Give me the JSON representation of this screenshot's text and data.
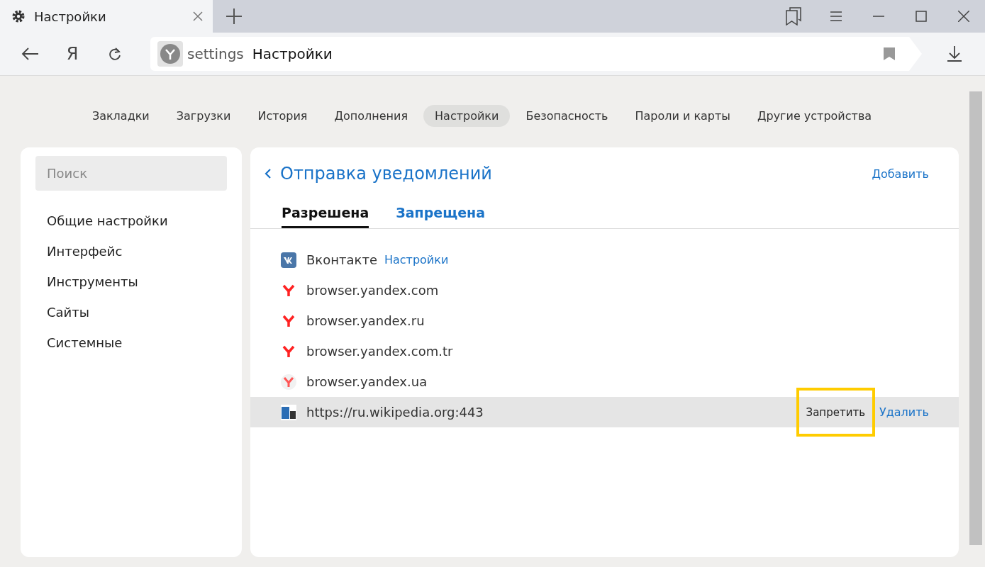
{
  "tab": {
    "title": "Настройки"
  },
  "toolbar": {
    "home_key": "Я",
    "address_scheme": "settings",
    "address_title": "Настройки"
  },
  "nav": [
    {
      "label": "Закладки",
      "selected": false
    },
    {
      "label": "Загрузки",
      "selected": false
    },
    {
      "label": "История",
      "selected": false
    },
    {
      "label": "Дополнения",
      "selected": false
    },
    {
      "label": "Настройки",
      "selected": true
    },
    {
      "label": "Безопасность",
      "selected": false
    },
    {
      "label": "Пароли и карты",
      "selected": false
    },
    {
      "label": "Другие устройства",
      "selected": false
    }
  ],
  "sidebar": {
    "search": {
      "placeholder": "Поиск"
    },
    "items": [
      "Общие настройки",
      "Интерфейс",
      "Инструменты",
      "Сайты",
      "Системные"
    ]
  },
  "panel": {
    "title": "Отправка уведомлений",
    "add": "Добавить",
    "tabs": [
      {
        "label": "Разрешена",
        "selected": true
      },
      {
        "label": "Запрещена",
        "selected": false
      }
    ],
    "sites": [
      {
        "kind": "vk",
        "name": "Вконтакте",
        "link": "Настройки",
        "hovered": false
      },
      {
        "kind": "yandex",
        "name": "browser.yandex.com",
        "hovered": false
      },
      {
        "kind": "yandex",
        "name": "browser.yandex.ru",
        "hovered": false
      },
      {
        "kind": "yandex",
        "name": "browser.yandex.com.tr",
        "hovered": false
      },
      {
        "kind": "yandex-faded",
        "name": "browser.yandex.ua",
        "hovered": false
      },
      {
        "kind": "sh",
        "name": "https://ru.wikipedia.org:443",
        "hovered": true,
        "block": "Запретить",
        "block_highlighted": true,
        "remove": "Удалить"
      }
    ]
  }
}
